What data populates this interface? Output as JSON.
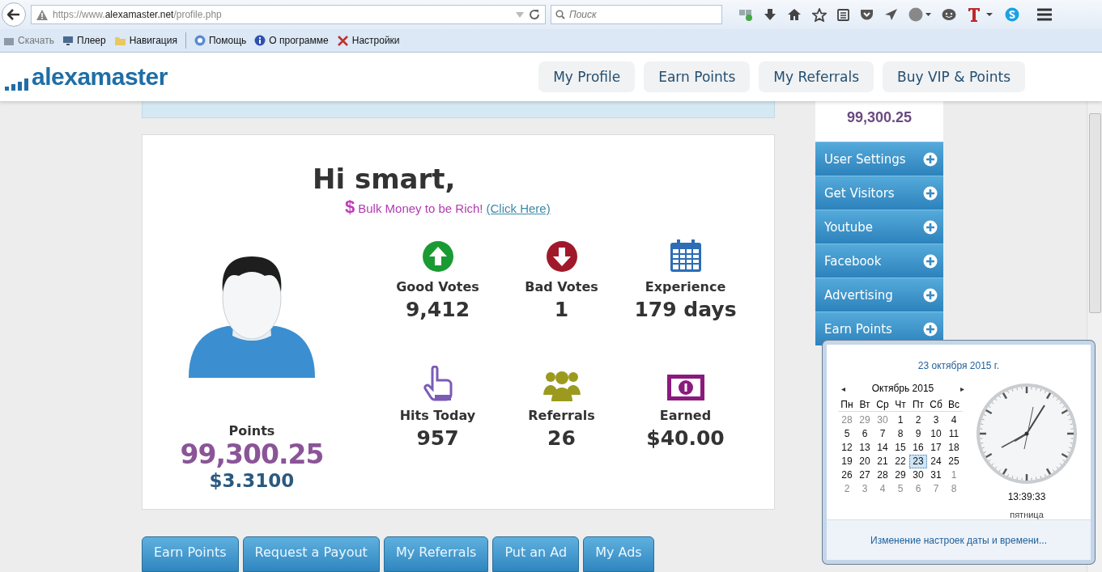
{
  "browser": {
    "url_prefix": "https://www.",
    "url_domain": "alexamaster.net",
    "url_path": "/profile.php",
    "search_placeholder": "Поиск",
    "bookmarks": [
      {
        "label": "Скачать",
        "disabled": true
      },
      {
        "label": "Плеер",
        "disabled": false
      },
      {
        "label": "Навигация",
        "disabled": false
      },
      {
        "label": "Помощь",
        "disabled": false
      },
      {
        "label": "О программе",
        "disabled": false
      },
      {
        "label": "Настройки",
        "disabled": false
      }
    ]
  },
  "site": {
    "logo": "alexamaster",
    "nav": [
      "My Profile",
      "Earn Points",
      "My Referrals",
      "Buy VIP & Points"
    ]
  },
  "profile": {
    "greeting": "Hi smart,",
    "promo_symbol": "$",
    "promo": "Bulk Money to be Rich!",
    "promo_link": "(Click Here)",
    "points_label": "Points",
    "points": "99,300.25",
    "usd": "$3.3100",
    "stats": [
      {
        "label": "Good Votes",
        "value": "9,412"
      },
      {
        "label": "Bad Votes",
        "value": "1"
      },
      {
        "label": "Experience",
        "value": "179 days"
      },
      {
        "label": "Hits Today",
        "value": "957"
      },
      {
        "label": "Referrals",
        "value": "26"
      },
      {
        "label": "Earned",
        "value": "$40.00"
      }
    ]
  },
  "sidebar": {
    "points": "99,300.25",
    "items": [
      "User Settings",
      "Get Visitors",
      "Youtube",
      "Facebook",
      "Advertising",
      "Earn Points"
    ]
  },
  "bottom_tabs": [
    "Earn Points",
    "Request a Payout",
    "My Referrals",
    "Put an Ad",
    "My Ads"
  ],
  "clock_popup": {
    "date": "23 октября 2015 г.",
    "month": "Октябрь 2015",
    "prev": "◂",
    "next": "▸",
    "weekdays": [
      "Пн",
      "Вт",
      "Ср",
      "Чт",
      "Пт",
      "Сб",
      "Вс"
    ],
    "days": [
      {
        "label": "28",
        "outside_month": true,
        "selected": false
      },
      {
        "label": "29",
        "outside_month": true,
        "selected": false
      },
      {
        "label": "30",
        "outside_month": true,
        "selected": false
      },
      {
        "label": "1",
        "outside_month": false,
        "selected": false
      },
      {
        "label": "2",
        "outside_month": false,
        "selected": false
      },
      {
        "label": "3",
        "outside_month": false,
        "selected": false
      },
      {
        "label": "4",
        "outside_month": false,
        "selected": false
      },
      {
        "label": "5",
        "outside_month": false,
        "selected": false
      },
      {
        "label": "6",
        "outside_month": false,
        "selected": false
      },
      {
        "label": "7",
        "outside_month": false,
        "selected": false
      },
      {
        "label": "8",
        "outside_month": false,
        "selected": false
      },
      {
        "label": "9",
        "outside_month": false,
        "selected": false
      },
      {
        "label": "10",
        "outside_month": false,
        "selected": false
      },
      {
        "label": "11",
        "outside_month": false,
        "selected": false
      },
      {
        "label": "12",
        "outside_month": false,
        "selected": false
      },
      {
        "label": "13",
        "outside_month": false,
        "selected": false
      },
      {
        "label": "14",
        "outside_month": false,
        "selected": false
      },
      {
        "label": "15",
        "outside_month": false,
        "selected": false
      },
      {
        "label": "16",
        "outside_month": false,
        "selected": false
      },
      {
        "label": "17",
        "outside_month": false,
        "selected": false
      },
      {
        "label": "18",
        "outside_month": false,
        "selected": false
      },
      {
        "label": "19",
        "outside_month": false,
        "selected": false
      },
      {
        "label": "20",
        "outside_month": false,
        "selected": false
      },
      {
        "label": "21",
        "outside_month": false,
        "selected": false
      },
      {
        "label": "22",
        "outside_month": false,
        "selected": false
      },
      {
        "label": "23",
        "outside_month": false,
        "selected": true
      },
      {
        "label": "24",
        "outside_month": false,
        "selected": false
      },
      {
        "label": "25",
        "outside_month": false,
        "selected": false
      },
      {
        "label": "26",
        "outside_month": false,
        "selected": false
      },
      {
        "label": "27",
        "outside_month": false,
        "selected": false
      },
      {
        "label": "28",
        "outside_month": false,
        "selected": false
      },
      {
        "label": "29",
        "outside_month": false,
        "selected": false
      },
      {
        "label": "30",
        "outside_month": false,
        "selected": false
      },
      {
        "label": "31",
        "outside_month": false,
        "selected": false
      },
      {
        "label": "1",
        "outside_month": true,
        "selected": false
      },
      {
        "label": "2",
        "outside_month": true,
        "selected": false
      },
      {
        "label": "3",
        "outside_month": true,
        "selected": false
      },
      {
        "label": "4",
        "outside_month": true,
        "selected": false
      },
      {
        "label": "5",
        "outside_month": true,
        "selected": false
      },
      {
        "label": "6",
        "outside_month": true,
        "selected": false
      },
      {
        "label": "7",
        "outside_month": true,
        "selected": false
      },
      {
        "label": "8",
        "outside_month": true,
        "selected": false
      }
    ],
    "time": "13:39:33",
    "weekday": "пятница",
    "settings_link": "Изменение настроек даты и времени..."
  }
}
